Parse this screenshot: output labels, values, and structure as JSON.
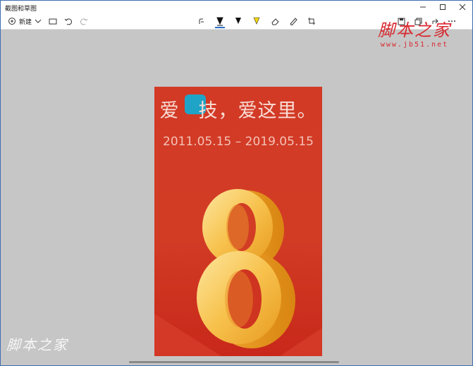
{
  "window": {
    "title": "截图和草图"
  },
  "toolbar": {
    "new_label": "新建",
    "tools": [
      {
        "name": "touch-writing-icon"
      },
      {
        "name": "ballpoint-pen-icon",
        "color": "#111111",
        "selected": true
      },
      {
        "name": "pencil-icon",
        "color": "#111111"
      },
      {
        "name": "highlighter-icon",
        "color": "#f5d800"
      },
      {
        "name": "eraser-icon"
      },
      {
        "name": "ruler-icon"
      },
      {
        "name": "crop-icon"
      }
    ],
    "right": [
      "save-icon",
      "copy-icon",
      "share-icon",
      "more-icon"
    ]
  },
  "image": {
    "headline_part1": "爱",
    "headline_part2": "技，爱这里。",
    "date": "2011.05.15 – 2019.05.15",
    "big_numeral": "8",
    "background_color": "#d23a26",
    "numeral_color": "#f5b93a"
  },
  "watermarks": {
    "top_cn": "脚本之家",
    "top_url": "www.jb51.net",
    "bottom_cn": "脚本之家"
  },
  "colors": {
    "accent": "#2b6fc9",
    "watermark": "#d8282f"
  }
}
